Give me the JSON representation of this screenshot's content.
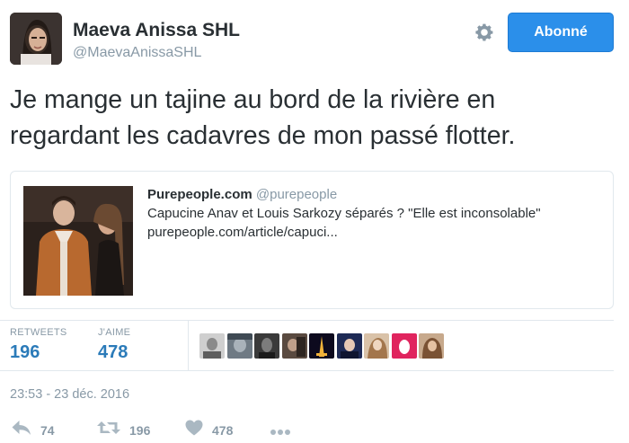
{
  "author": {
    "name": "Maeva Anissa SHL",
    "handle": "@MaevaAnissaSHL"
  },
  "follow_button": {
    "label": "Abonné"
  },
  "tweet": {
    "text_line1": "Je mange un tajine au bord de la rivière en",
    "text_line2": "regardant les cadavres de mon passé flotter."
  },
  "card": {
    "site_name": "Purepeople.com",
    "site_handle": "@purepeople",
    "title": "Capucine Anav et Louis Sarkozy séparés ? \"Elle est inconsolable\"",
    "url": "purepeople.com/article/capuci..."
  },
  "stats": {
    "retweets_label": "RETWEETS",
    "retweets_value": "196",
    "likes_label": "J'AIME",
    "likes_value": "478"
  },
  "timestamp": "23:53 - 23 déc. 2016",
  "actions": {
    "reply_count": "74",
    "retweet_count": "196",
    "like_count": "478"
  },
  "icons": {
    "settings": "gear-icon",
    "reply": "reply-icon",
    "retweet": "retweet-icon",
    "like": "heart-icon",
    "more": "more-icon"
  },
  "colors": {
    "accent": "#2b8fea",
    "link_blue": "#2b7bb9",
    "muted": "#8899a6",
    "border": "#e1e8ed",
    "text": "#292f33"
  }
}
